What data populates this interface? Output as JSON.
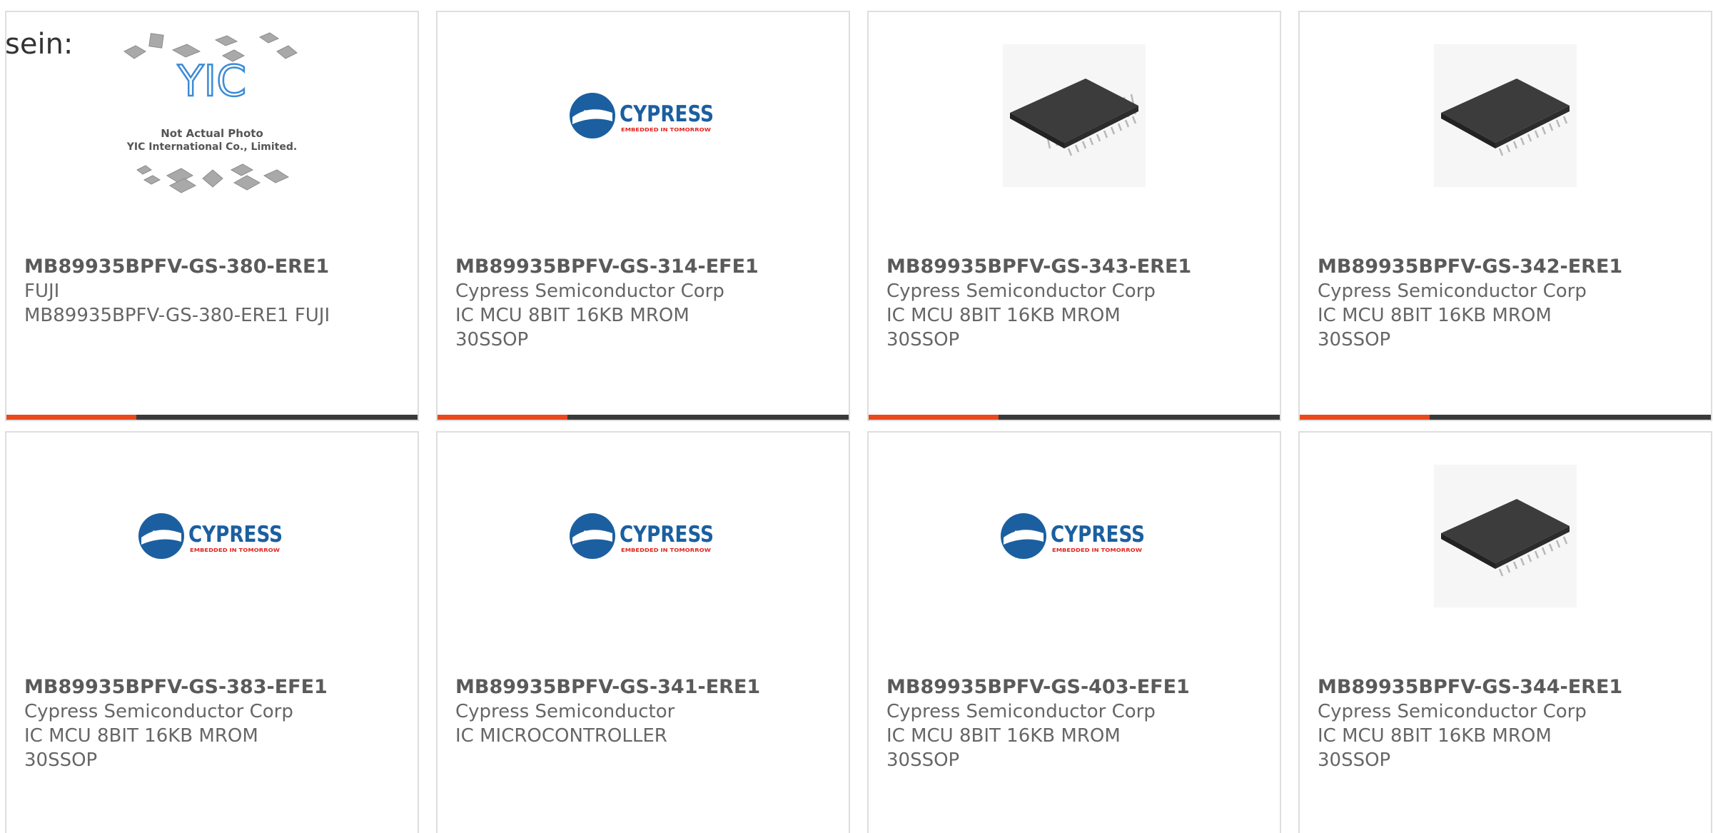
{
  "intro": "sein:",
  "colors": {
    "accent": "#e8491d",
    "bar": "#3a3a3a",
    "card_border": "#dedede",
    "cypress_blue": "#1b5fa0",
    "cypress_red": "#e0231c"
  },
  "products": [
    {
      "part_number": "MB89935BPFV-GS-380-ERE1",
      "manufacturer": "FUJI",
      "description": "MB89935BPFV-GS-380-ERE1 FUJI",
      "image": "yic-placeholder",
      "image_text": {
        "logo": "YIC",
        "line1": "Not Actual Photo",
        "line2": "YIC International Co., Limited."
      }
    },
    {
      "part_number": "MB89935BPFV-GS-314-EFE1",
      "manufacturer": "Cypress Semiconductor Corp",
      "description": "IC MCU 8BIT 16KB MROM 30SSOP",
      "image": "cypress-logo",
      "image_text": {
        "logo": "CYPRESS",
        "tagline": "EMBEDDED IN TOMORROW"
      }
    },
    {
      "part_number": "MB89935BPFV-GS-343-ERE1",
      "manufacturer": "Cypress Semiconductor Corp",
      "description": "IC MCU 8BIT 16KB MROM 30SSOP",
      "image": "ssop-chip"
    },
    {
      "part_number": "MB89935BPFV-GS-342-ERE1",
      "manufacturer": "Cypress Semiconductor Corp",
      "description": "IC MCU 8BIT 16KB MROM 30SSOP",
      "image": "ssop-chip"
    },
    {
      "part_number": "MB89935BPFV-GS-383-EFE1",
      "manufacturer": "Cypress Semiconductor Corp",
      "description": "IC MCU 8BIT 16KB MROM 30SSOP",
      "image": "cypress-logo",
      "image_text": {
        "logo": "CYPRESS",
        "tagline": "EMBEDDED IN TOMORROW"
      }
    },
    {
      "part_number": "MB89935BPFV-GS-341-ERE1",
      "manufacturer": "Cypress Semiconductor",
      "description": "IC MICROCONTROLLER",
      "image": "cypress-logo",
      "image_text": {
        "logo": "CYPRESS",
        "tagline": "EMBEDDED IN TOMORROW"
      }
    },
    {
      "part_number": "MB89935BPFV-GS-403-EFE1",
      "manufacturer": "Cypress Semiconductor Corp",
      "description": "IC MCU 8BIT 16KB MROM 30SSOP",
      "image": "cypress-logo",
      "image_text": {
        "logo": "CYPRESS",
        "tagline": "EMBEDDED IN TOMORROW"
      }
    },
    {
      "part_number": "MB89935BPFV-GS-344-ERE1",
      "manufacturer": "Cypress Semiconductor Corp",
      "description": "IC MCU 8BIT 16KB MROM 30SSOP",
      "image": "ssop-chip"
    }
  ]
}
